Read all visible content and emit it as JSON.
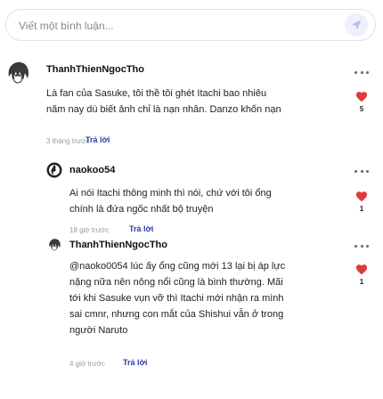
{
  "comment_input": {
    "placeholder": "Viết một bình luận..."
  },
  "accent_color": "#2b3aa6",
  "heart_color": "#e0393e",
  "comments": [
    {
      "author": "ThanhThienNgocTho",
      "avatar_icon": "naruto-avatar-icon",
      "text_lines": [
        "Là fan của Sasuke, tôi thề tôi ghét Itachi bao nhiêu",
        "năm nay dù biết ảnh chỉ là nạn nhân. Danzo khốn nạn"
      ],
      "time": "3 tháng trước",
      "reply_label": "Trả lời",
      "likes": "5"
    },
    {
      "author": "naokoo54",
      "avatar_icon": "sharingan-avatar-icon",
      "text_lines": [
        "Ai nói Itachi thông minh thì nói, chứ với tôi ổng",
        "chính là đứa ngốc nhất bộ truyện"
      ],
      "time": "18 giờ trước",
      "reply_label": "Trả lời",
      "likes": "1"
    },
    {
      "author": "ThanhThienNgocTho",
      "avatar_icon": "naruto-avatar-icon",
      "text_lines": [
        "@naoko0054 lúc ấy ổng cũng mới 13 lại bị áp lực",
        "nặng nữa nên nông nổi cũng là bình thường. Mãi",
        "tới khi Sasuke vụn vỡ thì Itachi mới nhận ra mình",
        "sai cmnr, nhưng con mắt của Shishui vẫn ở trong",
        "người Naruto"
      ],
      "time": "4 giờ trước",
      "reply_label": "Trả lời",
      "likes": "1"
    }
  ]
}
